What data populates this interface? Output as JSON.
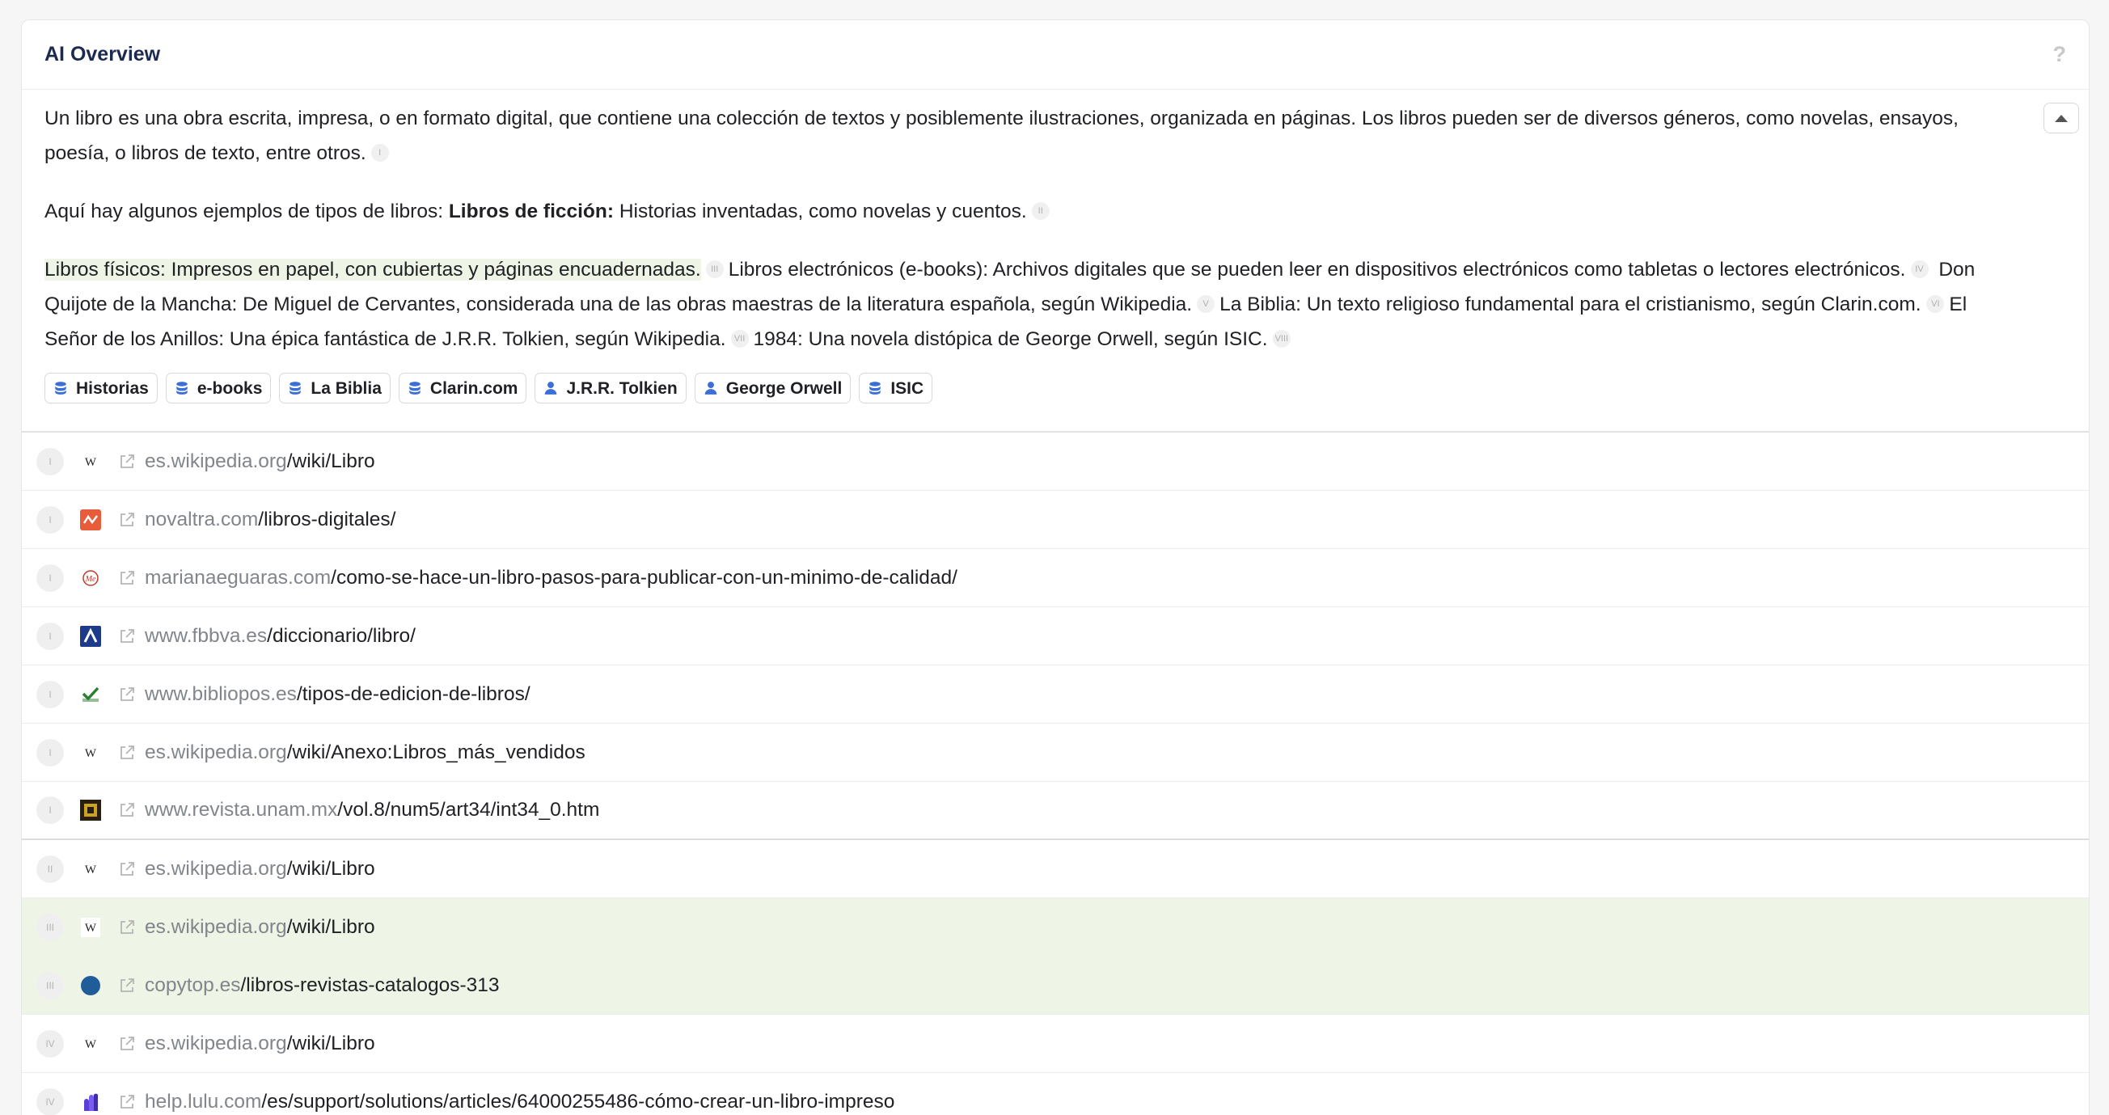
{
  "header": {
    "title": "AI Overview",
    "help": "?"
  },
  "overview": {
    "p1": "Un libro es una obra escrita, impresa, o en formato digital, que contiene una colección de textos y posiblemente ilustraciones, organizada en páginas. Los libros pueden ser de diversos géneros, como novelas, ensayos, poesía, o libros de texto, entre otros.",
    "p1_ref": "I",
    "p2_pre": "Aquí hay algunos ejemplos de tipos de libros: ",
    "p2_bold": "Libros de ficción:",
    "p2_post": " Historias inventadas, como novelas y cuentos.",
    "p2_ref": "II",
    "p3_hl": "Libros físicos: Impresos en papel, con cubiertas y páginas encuadernadas.",
    "p3_ref3": "III",
    "p3_ebooks": "Libros electrónicos (e-books): Archivos digitales que se pueden leer en dispositivos electrónicos como tabletas o lectores electrónicos.",
    "p3_ref4": "IV",
    "p3_quijote": "Don Quijote de la Mancha: De Miguel de Cervantes, considerada una de las obras maestras de la literatura española, según Wikipedia.",
    "p3_ref5": "V",
    "p3_biblia": "La Biblia: Un texto religioso fundamental para el cristianismo, según Clarin.com.",
    "p3_ref6": "VI",
    "p3_senor": "El Señor de los Anillos: Una épica fantástica de J.R.R. Tolkien, según Wikipedia.",
    "p3_ref7": "VII",
    "p3_1984": "1984: Una novela distópica de George Orwell, según ISIC.",
    "p3_ref8": "VIII"
  },
  "chips": [
    {
      "label": "Historias",
      "icon": "database-icon"
    },
    {
      "label": "e-books",
      "icon": "database-icon"
    },
    {
      "label": "La Biblia",
      "icon": "database-icon"
    },
    {
      "label": "Clarin.com",
      "icon": "database-icon"
    },
    {
      "label": "J.R.R. Tolkien",
      "icon": "person-icon"
    },
    {
      "label": "George Orwell",
      "icon": "person-icon"
    },
    {
      "label": "ISIC",
      "icon": "database-icon"
    }
  ],
  "sources": [
    {
      "num": "I",
      "domain": "es.wikipedia.org",
      "path": "/wiki/Libro",
      "favicon": "wikipedia"
    },
    {
      "num": "I",
      "domain": "novaltra.com",
      "path": "/libros-digitales/",
      "favicon": "novaltra"
    },
    {
      "num": "I",
      "domain": "marianaeguaras.com",
      "path": "/como-se-hace-un-libro-pasos-para-publicar-con-un-minimo-de-calidad/",
      "favicon": "mariana"
    },
    {
      "num": "I",
      "domain": "www.fbbva.es",
      "path": "/diccionario/libro/",
      "favicon": "fbbva"
    },
    {
      "num": "I",
      "domain": "www.bibliopos.es",
      "path": "/tipos-de-edicion-de-libros/",
      "favicon": "bibliopos"
    },
    {
      "num": "I",
      "domain": "es.wikipedia.org",
      "path": "/wiki/Anexo:Libros_más_vendidos",
      "favicon": "wikipedia"
    },
    {
      "num": "I",
      "domain": "www.revista.unam.mx",
      "path": "/vol.8/num5/art34/int34_0.htm",
      "favicon": "unam"
    },
    {
      "num": "II",
      "domain": "es.wikipedia.org",
      "path": "/wiki/Libro",
      "favicon": "wikipedia"
    },
    {
      "num": "III",
      "domain": "es.wikipedia.org",
      "path": "/wiki/Libro",
      "favicon": "wikipedia"
    },
    {
      "num": "III",
      "domain": "copytop.es",
      "path": "/libros-revistas-catalogos-313",
      "favicon": "copytop"
    },
    {
      "num": "IV",
      "domain": "es.wikipedia.org",
      "path": "/wiki/Libro",
      "favicon": "wikipedia"
    },
    {
      "num": "IV",
      "domain": "help.lulu.com",
      "path": "/es/support/solutions/articles/64000255486-cómo-crear-un-libro-impreso",
      "favicon": "lulu"
    }
  ],
  "colors": {
    "accent": "#1b2a4e",
    "highlight": "#eef4e6",
    "chip_icon": "#3c6fd6"
  }
}
